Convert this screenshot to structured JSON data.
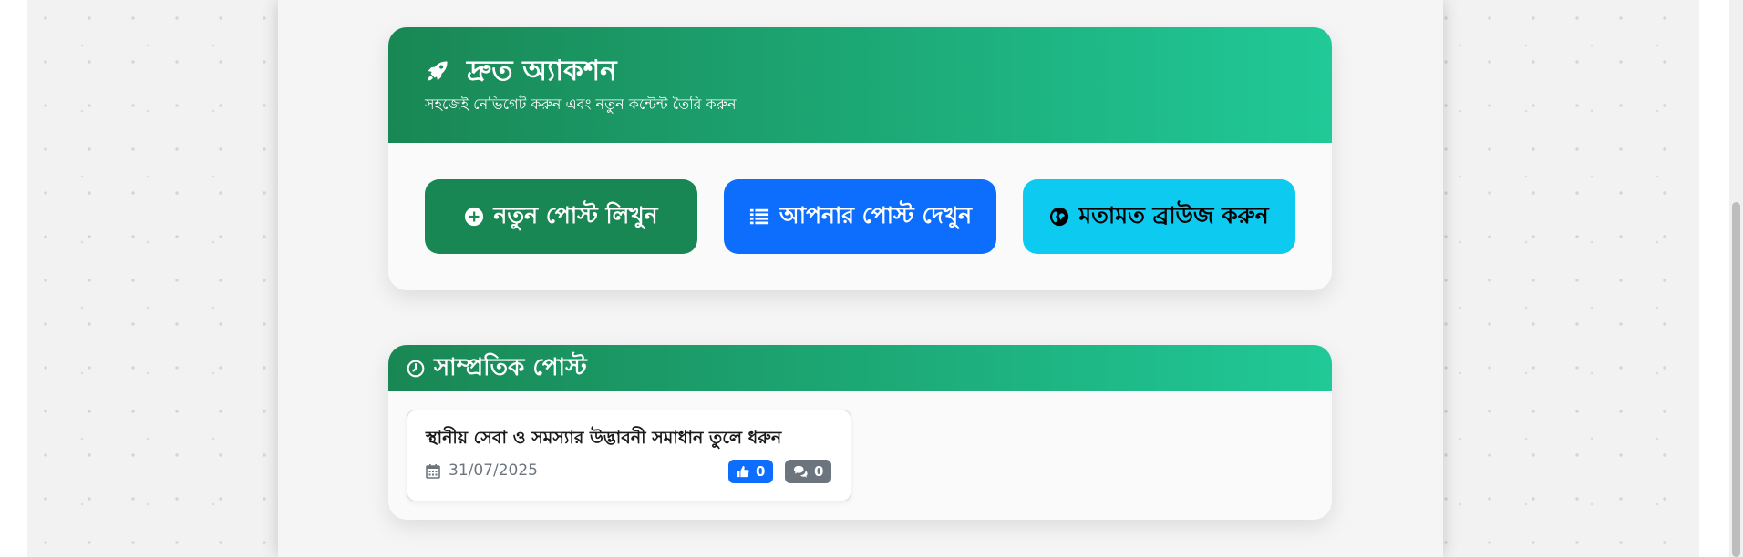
{
  "quick_actions": {
    "title": "দ্রুত অ্যাকশন",
    "subtitle": "সহজেই নেভিগেট করুন এবং নতুন কন্টেন্ট তৈরি করুন",
    "icon": "rocket-icon",
    "buttons": [
      {
        "label": "নতুন পোস্ট লিখুন",
        "icon": "plus-circle-icon",
        "color": "#198754"
      },
      {
        "label": "আপনার পোস্ট দেখুন",
        "icon": "list-icon",
        "color": "#0d6efd"
      },
      {
        "label": "মতামত ব্রাউজ করুন",
        "icon": "globe-icon",
        "color": "#0dcaf0"
      }
    ]
  },
  "recent_posts": {
    "title": "সাম্প্রতিক পোস্ট",
    "icon": "clock-icon",
    "items": [
      {
        "title": "স্থানীয় সেবা ও সমস্যার উদ্ভাবনী সমাধান তুলে ধরুন",
        "date": "31/07/2025",
        "likes": "0",
        "comments": "0"
      }
    ]
  },
  "colors": {
    "header_gradient_start": "#198754",
    "header_gradient_end": "#20c997"
  }
}
